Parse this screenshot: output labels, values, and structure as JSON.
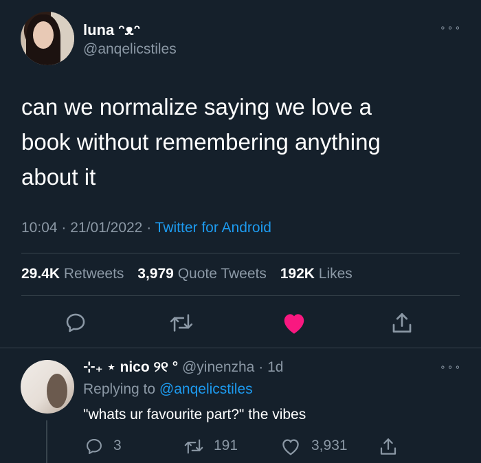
{
  "tweet": {
    "author_name": "luna ᵔᴥᵔ",
    "author_handle": "@anqelicstiles",
    "text_line1": "can we normalize saying we love a",
    "text_line2": "book without remembering anything",
    "text_line3": "about it",
    "time": "10:04",
    "date": "21/01/2022",
    "separator": "·",
    "source": "Twitter for Android",
    "more_glyph": "∘∘∘",
    "stats": {
      "retweets_count": "29.4K",
      "retweets_label": "Retweets",
      "quotes_count": "3,979",
      "quotes_label": "Quote Tweets",
      "likes_count": "192K",
      "likes_label": "Likes"
    },
    "liked": true,
    "like_color": "#f91880"
  },
  "reply": {
    "author_name": "⊹₊ ⋆ nico ୨୧ °",
    "author_handle": "@yinenzha",
    "age": "1d",
    "separator": "·",
    "replying_label": "Replying to",
    "replying_handle": "@anqelicstiles",
    "text": "\"whats ur favourite part?\" the vibes",
    "reply_count": "3",
    "retweet_count": "191",
    "like_count": "3,931",
    "more_glyph": "∘∘∘"
  },
  "icons": [
    "reply-icon",
    "retweet-icon",
    "heart-icon",
    "share-icon",
    "more-icon"
  ],
  "colors": {
    "background": "#15202b",
    "text_secondary": "#8b98a5",
    "accent": "#1d9bf0",
    "divider": "#38444d"
  }
}
